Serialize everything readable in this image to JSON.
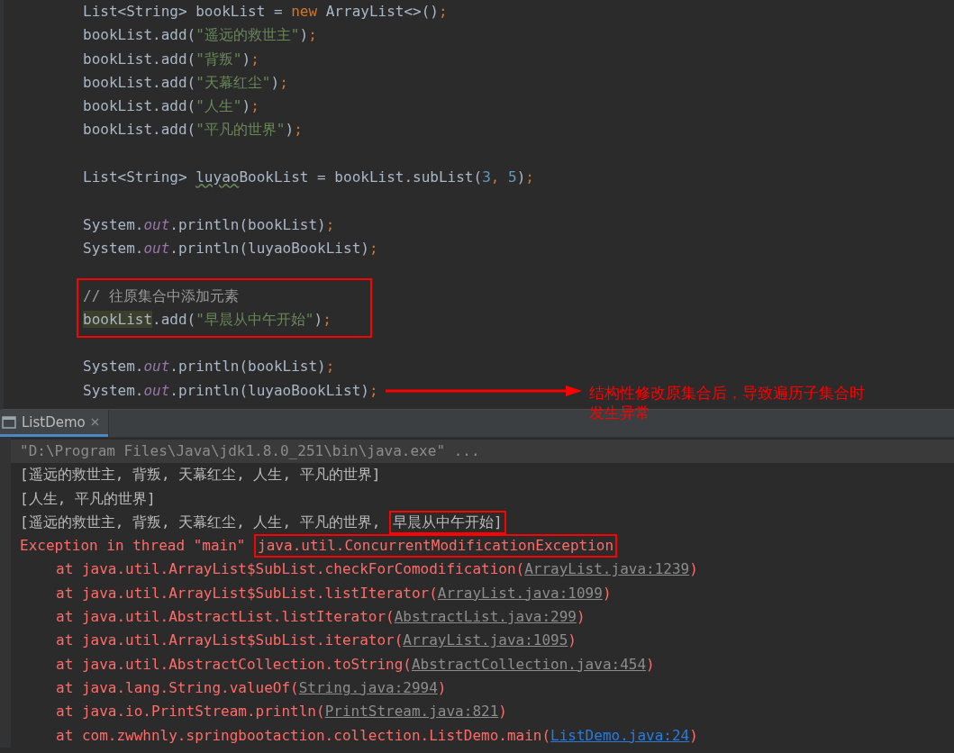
{
  "editor": {
    "lines": [
      {
        "kind": "code",
        "tokens": [
          {
            "kind": "plain",
            "text": "List<String> bookList = "
          },
          {
            "kind": "keyword",
            "text": "new"
          },
          {
            "kind": "plain",
            "text": " ArrayList<>()"
          },
          {
            "kind": "punct",
            "text": ";"
          }
        ]
      },
      {
        "kind": "code",
        "tokens": [
          {
            "kind": "plain",
            "text": "bookList.add("
          },
          {
            "kind": "string",
            "text": "\"遥远的救世主\""
          },
          {
            "kind": "plain",
            "text": ")"
          },
          {
            "kind": "punct",
            "text": ";"
          }
        ]
      },
      {
        "kind": "code",
        "tokens": [
          {
            "kind": "plain",
            "text": "bookList.add("
          },
          {
            "kind": "string",
            "text": "\"背叛\""
          },
          {
            "kind": "plain",
            "text": ")"
          },
          {
            "kind": "punct",
            "text": ";"
          }
        ]
      },
      {
        "kind": "code",
        "tokens": [
          {
            "kind": "plain",
            "text": "bookList.add("
          },
          {
            "kind": "string",
            "text": "\"天幕红尘\""
          },
          {
            "kind": "plain",
            "text": ")"
          },
          {
            "kind": "punct",
            "text": ";"
          }
        ]
      },
      {
        "kind": "code",
        "tokens": [
          {
            "kind": "plain",
            "text": "bookList.add("
          },
          {
            "kind": "string",
            "text": "\"人生\""
          },
          {
            "kind": "plain",
            "text": ")"
          },
          {
            "kind": "punct",
            "text": ";"
          }
        ]
      },
      {
        "kind": "code",
        "tokens": [
          {
            "kind": "plain",
            "text": "bookList.add("
          },
          {
            "kind": "string",
            "text": "\"平凡的世界\""
          },
          {
            "kind": "plain",
            "text": ")"
          },
          {
            "kind": "punct",
            "text": ";"
          }
        ]
      },
      {
        "kind": "blank"
      },
      {
        "kind": "code",
        "tokens": [
          {
            "kind": "plain",
            "text": "List<String> "
          },
          {
            "kind": "squiggle",
            "text": "luyao"
          },
          {
            "kind": "plain",
            "text": "BookList = bookList.subList("
          },
          {
            "kind": "number",
            "text": "3"
          },
          {
            "kind": "punct",
            "text": ", "
          },
          {
            "kind": "number",
            "text": "5"
          },
          {
            "kind": "plain",
            "text": ")"
          },
          {
            "kind": "punct",
            "text": ";"
          }
        ]
      },
      {
        "kind": "blank"
      },
      {
        "kind": "code",
        "tokens": [
          {
            "kind": "plain",
            "text": "System."
          },
          {
            "kind": "field",
            "text": "out"
          },
          {
            "kind": "plain",
            "text": ".println(bookList)"
          },
          {
            "kind": "punct",
            "text": ";"
          }
        ]
      },
      {
        "kind": "code",
        "tokens": [
          {
            "kind": "plain",
            "text": "System."
          },
          {
            "kind": "field",
            "text": "out"
          },
          {
            "kind": "plain",
            "text": ".println(luyaoBookList)"
          },
          {
            "kind": "punct",
            "text": ";"
          }
        ]
      },
      {
        "kind": "blank"
      },
      {
        "kind": "box",
        "lines": [
          {
            "kind": "code",
            "tokens": [
              {
                "kind": "comment",
                "text": "// 往原集合中添加元素"
              }
            ]
          },
          {
            "kind": "code",
            "tokens": [
              {
                "kind": "highlight",
                "text": "bookList"
              },
              {
                "kind": "plain",
                "text": ".add("
              },
              {
                "kind": "string",
                "text": "\"早晨从中午开始\""
              },
              {
                "kind": "plain",
                "text": ")"
              },
              {
                "kind": "punct",
                "text": ";"
              }
            ]
          }
        ]
      },
      {
        "kind": "blank"
      },
      {
        "kind": "code",
        "tokens": [
          {
            "kind": "plain",
            "text": "System."
          },
          {
            "kind": "field",
            "text": "out"
          },
          {
            "kind": "plain",
            "text": ".println(bookList)"
          },
          {
            "kind": "punct",
            "text": ";"
          }
        ]
      },
      {
        "kind": "code",
        "note": "结构性修改原集合后，导致遍历子集合时发生异常",
        "tokens": [
          {
            "kind": "plain",
            "text": "System."
          },
          {
            "kind": "field",
            "text": "out"
          },
          {
            "kind": "plain",
            "text": ".println(luyaoBookList)"
          },
          {
            "kind": "punct",
            "text": ";"
          }
        ]
      }
    ]
  },
  "console": {
    "tab": {
      "label": "ListDemo",
      "selected": true
    },
    "lines": [
      {
        "kind": "command",
        "parts": [
          {
            "text": "\"D:\\Program Files\\Java\\jdk1.8.0_251\\bin\\java.exe\" ...",
            "boxed": false
          }
        ]
      },
      {
        "kind": "output",
        "parts": [
          {
            "text": "[遥远的救世主, 背叛, 天幕红尘, 人生, 平凡的世界]",
            "boxed": false
          }
        ]
      },
      {
        "kind": "output",
        "parts": [
          {
            "text": "[人生, 平凡的世界]",
            "boxed": false
          }
        ]
      },
      {
        "kind": "output",
        "parts": [
          {
            "text": "[遥远的救世主, 背叛, 天幕红尘, 人生, 平凡的世界, ",
            "boxed": false
          },
          {
            "text": "早晨从中午开始]",
            "boxed": true
          }
        ]
      },
      {
        "kind": "exception",
        "parts": [
          {
            "text": "Exception in thread \"main\" ",
            "boxed": false
          },
          {
            "text": "java.util.ConcurrentModificationException",
            "boxed": true
          }
        ]
      },
      {
        "kind": "frame",
        "text": "at java.util.ArrayList$SubList.checkForComodification(",
        "link": "ArrayList.java:1239",
        "color": "#8c8c8c",
        "tail": ")"
      },
      {
        "kind": "frame",
        "text": "at java.util.ArrayList$SubList.listIterator(",
        "link": "ArrayList.java:1099",
        "color": "#8c8c8c",
        "tail": ")"
      },
      {
        "kind": "frame",
        "text": "at java.util.AbstractList.listIterator(",
        "link": "AbstractList.java:299",
        "color": "#8c8c8c",
        "tail": ")"
      },
      {
        "kind": "frame",
        "text": "at java.util.ArrayList$SubList.iterator(",
        "link": "ArrayList.java:1095",
        "color": "#8c8c8c",
        "tail": ")"
      },
      {
        "kind": "frame",
        "text": "at java.util.AbstractCollection.toString(",
        "link": "AbstractCollection.java:454",
        "color": "#8c8c8c",
        "tail": ")"
      },
      {
        "kind": "frame",
        "text": "at java.lang.String.valueOf(",
        "link": "String.java:2994",
        "color": "#8c8c8c",
        "tail": ")"
      },
      {
        "kind": "frame",
        "text": "at java.io.PrintStream.println(",
        "link": "PrintStream.java:821",
        "color": "#8c8c8c",
        "tail": ")"
      },
      {
        "kind": "frame",
        "text": "at com.zwwhnly.springbootaction.collection.ListDemo.main(",
        "link": "ListDemo.java:24",
        "color": "#287bde",
        "tail": ")"
      }
    ]
  }
}
